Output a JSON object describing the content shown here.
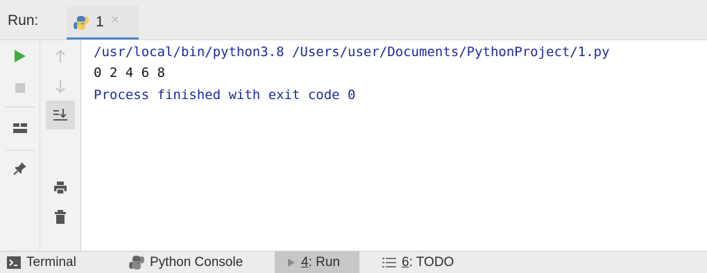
{
  "header": {
    "run_label": "Run:",
    "tab_label": "1",
    "tab_close": "×"
  },
  "console": {
    "command": "/usr/local/bin/python3.8 /Users/user/Documents/PythonProject/1.py",
    "output": "0 2 4 6 8",
    "finished": "Process finished with exit code 0"
  },
  "bottom_bar": {
    "terminal": "Terminal",
    "python_console": "Python Console",
    "run_num": "4",
    "run_rest": ": Run",
    "todo_num": "6",
    "todo_rest": ": TODO"
  },
  "colors": {
    "run_green": "#3fae3f",
    "console_blue": "#1f2a9a",
    "tab_underline": "#4a88c7"
  }
}
